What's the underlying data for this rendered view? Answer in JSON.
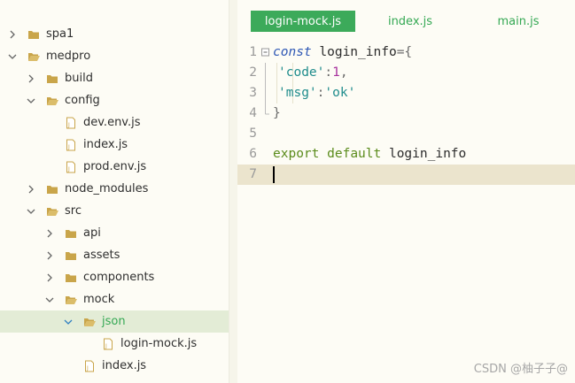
{
  "sidebar": {
    "items": [
      {
        "label": "spa1",
        "type": "folder",
        "open": false
      },
      {
        "label": "medpro",
        "type": "folder",
        "open": true
      },
      {
        "label": "build",
        "type": "folder",
        "open": false
      },
      {
        "label": "config",
        "type": "folder",
        "open": true
      },
      {
        "label": "dev.env.js",
        "type": "file"
      },
      {
        "label": "index.js",
        "type": "file"
      },
      {
        "label": "prod.env.js",
        "type": "file"
      },
      {
        "label": "node_modules",
        "type": "folder",
        "open": false
      },
      {
        "label": "src",
        "type": "folder",
        "open": true
      },
      {
        "label": "api",
        "type": "folder",
        "open": false
      },
      {
        "label": "assets",
        "type": "folder",
        "open": false
      },
      {
        "label": "components",
        "type": "folder",
        "open": false
      },
      {
        "label": "mock",
        "type": "folder",
        "open": true
      },
      {
        "label": "json",
        "type": "folder",
        "open": true,
        "selected": true
      },
      {
        "label": "login-mock.js",
        "type": "file"
      },
      {
        "label": "index.js",
        "type": "file"
      }
    ]
  },
  "tabs": [
    {
      "label": "login-mock.js",
      "active": true
    },
    {
      "label": "index.js",
      "active": false
    },
    {
      "label": "main.js",
      "active": false
    }
  ],
  "editor": {
    "lines": [
      {
        "num": "1",
        "tokens": [
          [
            "const",
            "kw-const"
          ],
          [
            " login_info",
            "ident"
          ],
          [
            "={",
            "op"
          ]
        ]
      },
      {
        "num": "2",
        "tokens": [
          [
            "'code'",
            "str"
          ],
          [
            ":",
            "op"
          ],
          [
            "1",
            "num"
          ],
          [
            ",",
            "op"
          ]
        ]
      },
      {
        "num": "3",
        "tokens": [
          [
            "'msg'",
            "str"
          ],
          [
            ":",
            "op"
          ],
          [
            "'ok'",
            "str"
          ]
        ]
      },
      {
        "num": "4",
        "tokens": [
          [
            "}",
            "op"
          ]
        ]
      },
      {
        "num": "5",
        "tokens": []
      },
      {
        "num": "6",
        "tokens": [
          [
            "export",
            "kw"
          ],
          [
            " ",
            "ident"
          ],
          [
            "default",
            "kw"
          ],
          [
            " login_info",
            "ident"
          ]
        ]
      },
      {
        "num": "7",
        "tokens": []
      }
    ]
  },
  "watermark": "CSDN @柚子子@",
  "colors": {
    "accent_green": "#3caa5a",
    "selection_bg": "#e3ecd6",
    "current_line": "#ebe4cd",
    "folder": "#c9a54a"
  }
}
